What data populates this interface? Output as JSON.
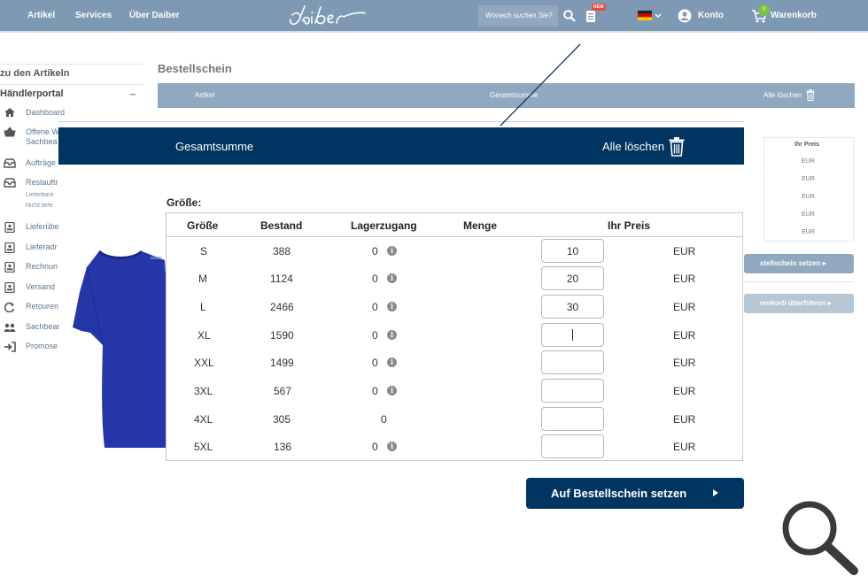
{
  "nav": {
    "links": [
      "Artikel",
      "Services",
      "Über Daiber"
    ],
    "logo_text": "daiber",
    "search_placeholder": "Wonach suchen Sie?",
    "new_badge": "NEW",
    "account": "Konto",
    "cart": "Warenkorb",
    "cart_count": "0",
    "colors": {
      "bar": "#7d99b3",
      "accent_dark": "#003461",
      "cart_badge": "#7ec142"
    }
  },
  "sidebar": {
    "back": "zu den Artikeln",
    "portal": "Händlerportal",
    "items": [
      {
        "label": "Dashboard",
        "icon": "home-icon"
      },
      {
        "label": "Offene W",
        "sub": "Sachbea",
        "icon": "basket-icon"
      },
      {
        "label": "Aufträge",
        "icon": "inbox-icon"
      },
      {
        "label": "Restauftr",
        "icon": "inbox-icon",
        "subs": [
          "Lieferbare",
          "Nicht liefe"
        ]
      },
      {
        "label": "Lieferübe",
        "icon": "document-icon"
      },
      {
        "label": "Lieferadr",
        "icon": "document-icon"
      },
      {
        "label": "Rechnun",
        "icon": "document-icon"
      },
      {
        "label": "Versand",
        "icon": "document-icon"
      },
      {
        "label": "Retouren",
        "icon": "refresh-icon"
      },
      {
        "label": "Sachbear",
        "icon": "users-icon"
      },
      {
        "label": "Promose",
        "icon": "login-icon"
      }
    ]
  },
  "background": {
    "title": "Bestellschein",
    "header": {
      "article": "Artikel",
      "total": "Gesamtsumme",
      "clear": "Alle löschen"
    },
    "price_header": "Ihr Preis",
    "currency_rows": [
      "EUR",
      "EUR",
      "EUR",
      "EUR",
      "EUR"
    ],
    "btn_order": "stellschein setzen",
    "btn_cart": "renkorb überführen"
  },
  "modal": {
    "total_label": "Gesamtsumme",
    "clear_label": "Alle löschen",
    "size_title": "Größe:",
    "columns": [
      "Größe",
      "Bestand",
      "Lagerzugang",
      "Menge",
      "Ihr Preis"
    ],
    "rows": [
      {
        "size": "S",
        "stock": "388",
        "incoming": "0",
        "info": true,
        "qty": "10",
        "currency": "EUR"
      },
      {
        "size": "M",
        "stock": "1124",
        "incoming": "0",
        "info": true,
        "qty": "20",
        "currency": "EUR"
      },
      {
        "size": "L",
        "stock": "2466",
        "incoming": "0",
        "info": true,
        "qty": "30",
        "currency": "EUR"
      },
      {
        "size": "XL",
        "stock": "1590",
        "incoming": "0",
        "info": true,
        "qty": "",
        "currency": "EUR",
        "focused": true
      },
      {
        "size": "XXL",
        "stock": "1499",
        "incoming": "0",
        "info": true,
        "qty": "",
        "currency": "EUR"
      },
      {
        "size": "3XL",
        "stock": "567",
        "incoming": "0",
        "info": true,
        "qty": "",
        "currency": "EUR"
      },
      {
        "size": "4XL",
        "stock": "305",
        "incoming": "0",
        "info": false,
        "qty": "",
        "currency": "EUR"
      },
      {
        "size": "5XL",
        "stock": "136",
        "incoming": "0",
        "info": true,
        "qty": "",
        "currency": "EUR"
      }
    ],
    "order_button": "Auf Bestellschein setzen"
  },
  "product": {
    "image": "tshirt-image",
    "color": "#2536a8"
  }
}
